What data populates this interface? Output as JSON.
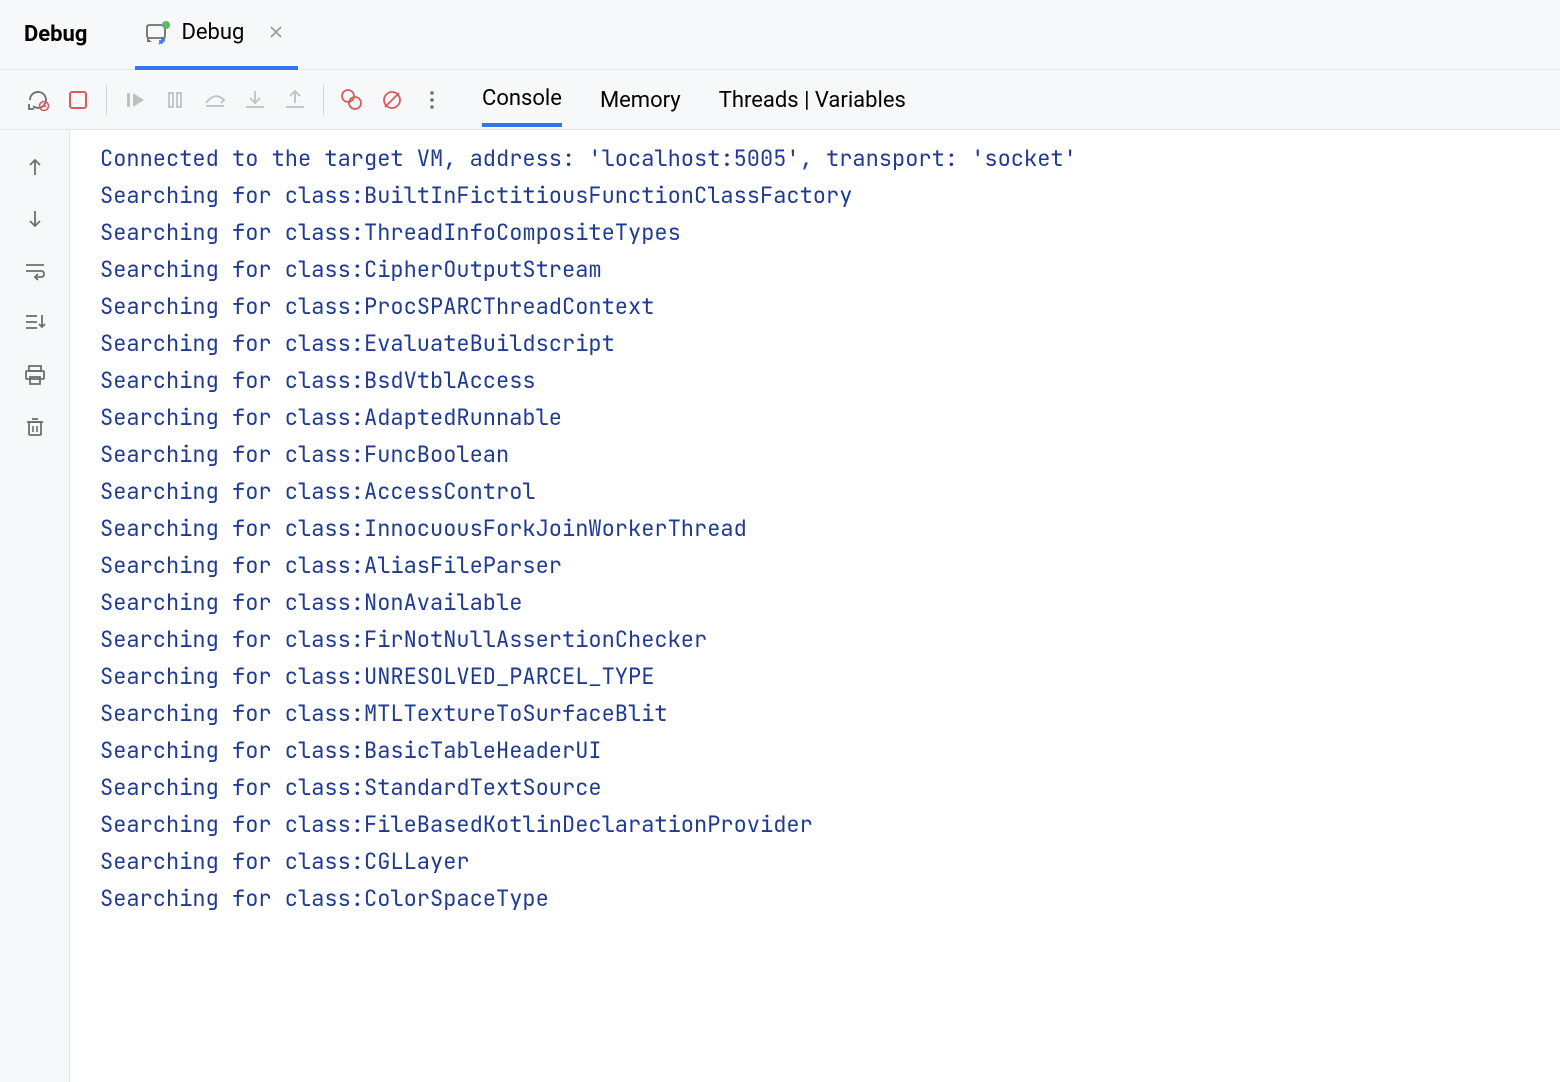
{
  "header": {
    "title": "Debug",
    "tab": {
      "label": "Debug"
    }
  },
  "debugTabs": {
    "console": "Console",
    "memory": "Memory",
    "threads": "Threads | Variables"
  },
  "icons": {
    "rerun": "rerun",
    "stop": "stop",
    "resume": "resume",
    "pause": "pause",
    "stepOver": "step-over",
    "stepInto": "step-into",
    "stepOut": "step-out",
    "viewBreakpoints": "view-breakpoints",
    "muteBreakpoints": "mute-breakpoints",
    "more": "more"
  },
  "console": [
    "Connected to the target VM, address: 'localhost:5005', transport: 'socket'",
    "Searching for class:BuiltInFictitiousFunctionClassFactory",
    "Searching for class:ThreadInfoCompositeTypes",
    "Searching for class:CipherOutputStream",
    "Searching for class:ProcSPARCThreadContext",
    "Searching for class:EvaluateBuildscript",
    "Searching for class:BsdVtblAccess",
    "Searching for class:AdaptedRunnable",
    "Searching for class:FuncBoolean",
    "Searching for class:AccessControl",
    "Searching for class:InnocuousForkJoinWorkerThread",
    "Searching for class:AliasFileParser",
    "Searching for class:NonAvailable",
    "Searching for class:FirNotNullAssertionChecker",
    "Searching for class:UNRESOLVED_PARCEL_TYPE",
    "Searching for class:MTLTextureToSurfaceBlit",
    "Searching for class:BasicTableHeaderUI",
    "Searching for class:StandardTextSource",
    "Searching for class:FileBasedKotlinDeclarationProvider",
    "Searching for class:CGLLayer",
    "Searching for class:ColorSpaceType"
  ]
}
